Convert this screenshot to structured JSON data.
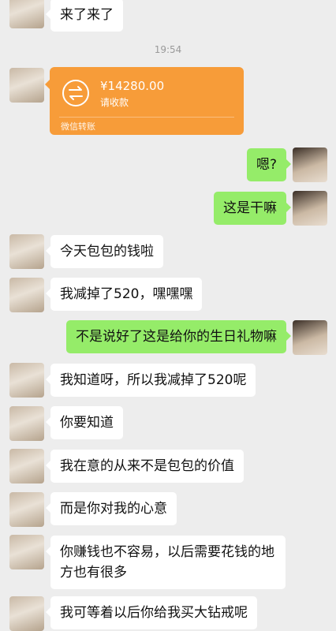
{
  "timestamp": "19:54",
  "transfer": {
    "amount": "¥14280.00",
    "status": "请收款",
    "footer": "微信转账",
    "icon": "transfer-arrows-icon",
    "color": "#f79c39"
  },
  "messages": [
    {
      "side": "left",
      "text": "来了来了"
    },
    {
      "side": "right",
      "text": "嗯?"
    },
    {
      "side": "right",
      "text": "这是干嘛"
    },
    {
      "side": "left",
      "text": "今天包包的钱啦"
    },
    {
      "side": "left",
      "text": "我减掉了520，嘿嘿嘿"
    },
    {
      "side": "right",
      "text": "不是说好了这是给你的生日礼物嘛"
    },
    {
      "side": "left",
      "text": "我知道呀，所以我减掉了520呢"
    },
    {
      "side": "left",
      "text": "你要知道"
    },
    {
      "side": "left",
      "text": "我在意的从来不是包包的价值"
    },
    {
      "side": "left",
      "text": "而是你对我的心意"
    },
    {
      "side": "left",
      "text": "你赚钱也不容易，以后需要花钱的地方也有很多"
    },
    {
      "side": "left",
      "text": "我可等着以后你给我买大钻戒呢"
    }
  ],
  "colors": {
    "background": "#ededed",
    "self_bubble": "#95ec69",
    "other_bubble": "#ffffff"
  }
}
